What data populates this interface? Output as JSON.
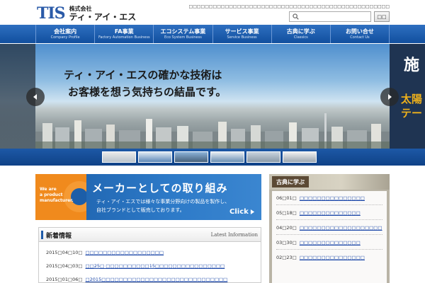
{
  "header": {
    "logo_mark": "TIS",
    "company_label": "株式会社",
    "company_name": "ティ・アイ・エス",
    "tagline": "□□□□□□□□□□□□□□□□□□□□□□□□□□□□□□□□□□□□□□□□□□□□□□□□□□",
    "search": {
      "value": "",
      "placeholder": ""
    },
    "search_button": "□□"
  },
  "nav": [
    {
      "jp": "会社案内",
      "en": "Company Profile"
    },
    {
      "jp": "FA事業",
      "en": "Factory Automation Business"
    },
    {
      "jp": "エコシステム事業",
      "en": "Eco System Business"
    },
    {
      "jp": "サービス事業",
      "en": "Service Business"
    },
    {
      "jp": "古典に学ぶ",
      "en": "Classics"
    },
    {
      "jp": "お問い合せ",
      "en": "Contact Us"
    }
  ],
  "hero": {
    "caption_line1": "ティ・アイ・エスの確かな技術は",
    "caption_line2": "お客様を想う気持ちの結晶です。",
    "right_title": "施",
    "right_sub1": "太陽",
    "right_sub2": "テー"
  },
  "banner": {
    "gear_text_1": "We are",
    "gear_text_2": "a product",
    "gear_text_3": "manufacturer.",
    "title": "メーカーとしての取り組み",
    "sub1": "ティ・アイ・エスでは様々な事業分野向けの製品を製作し、",
    "sub2": "自社ブランドとして販売しております。",
    "click": "Click"
  },
  "news": {
    "title": "新着情報",
    "title_en": "Latest Information",
    "items": [
      {
        "date": "2015□04□10□",
        "text": "□□□□□□□□□□□□□□□□□□"
      },
      {
        "date": "2015□04□03□",
        "text": "□□25□ □□□□□□□□□□15□□□□□□□□□□□□□□□□"
      },
      {
        "date": "2015□01□06□",
        "text": "□2015□□□□□□□□□□□□□□□□□□□□□□□□□□□□□"
      }
    ]
  },
  "classics": {
    "label": "古典に学ぶ",
    "items": [
      {
        "date": "06□01□",
        "text": "□□□□□□□□□□□□□□□"
      },
      {
        "date": "05□18□",
        "text": "□□□□□□□□□□□□□□"
      },
      {
        "date": "04□20□",
        "text": "□□□□□□□□□□□□□□□□□□□"
      },
      {
        "date": "03□30□",
        "text": "□□□□□□□□□□□□□□"
      },
      {
        "date": "02□23□",
        "text": "□□□□□□□□□□□□□□□"
      }
    ]
  },
  "colors": {
    "brand_blue": "#1e5aa8",
    "accent_orange": "#f08a1d",
    "link": "#1a46a8"
  }
}
